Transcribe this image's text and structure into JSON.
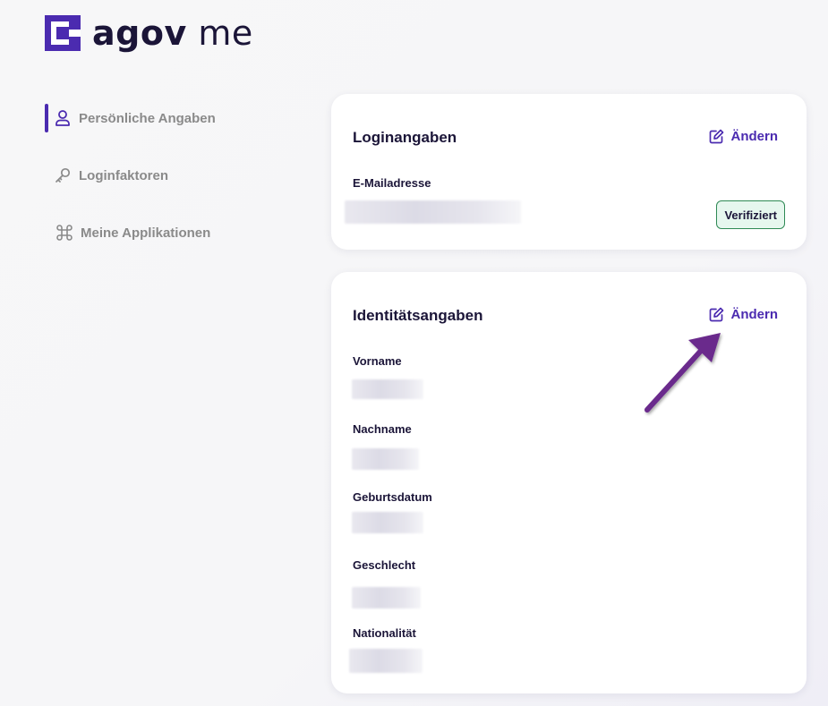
{
  "app": {
    "logo_text_bold": "agov",
    "logo_text_light": "me"
  },
  "colors": {
    "brand": "#4b2bb0",
    "dark": "#1b1538",
    "verified_border": "#2f8a55",
    "verified_bg": "#e6f7ee",
    "arrow": "#6a2a8c"
  },
  "sidebar": {
    "items": [
      {
        "label": "Persönliche Angaben",
        "icon": "user-icon",
        "active": true
      },
      {
        "label": "Loginfaktoren",
        "icon": "key-icon",
        "active": false
      },
      {
        "label": "Meine Applikationen",
        "icon": "command-icon",
        "active": false
      }
    ]
  },
  "login_card": {
    "title": "Loginangaben",
    "edit_label": "Ändern",
    "email_label": "E-Mailadresse",
    "verified_badge": "Verifiziert"
  },
  "identity_card": {
    "title": "Identitätsangaben",
    "edit_label": "Ändern",
    "fields": [
      {
        "label": "Vorname"
      },
      {
        "label": "Nachname"
      },
      {
        "label": "Geburtsdatum"
      },
      {
        "label": "Geschlecht"
      },
      {
        "label": "Nationalität"
      }
    ]
  }
}
